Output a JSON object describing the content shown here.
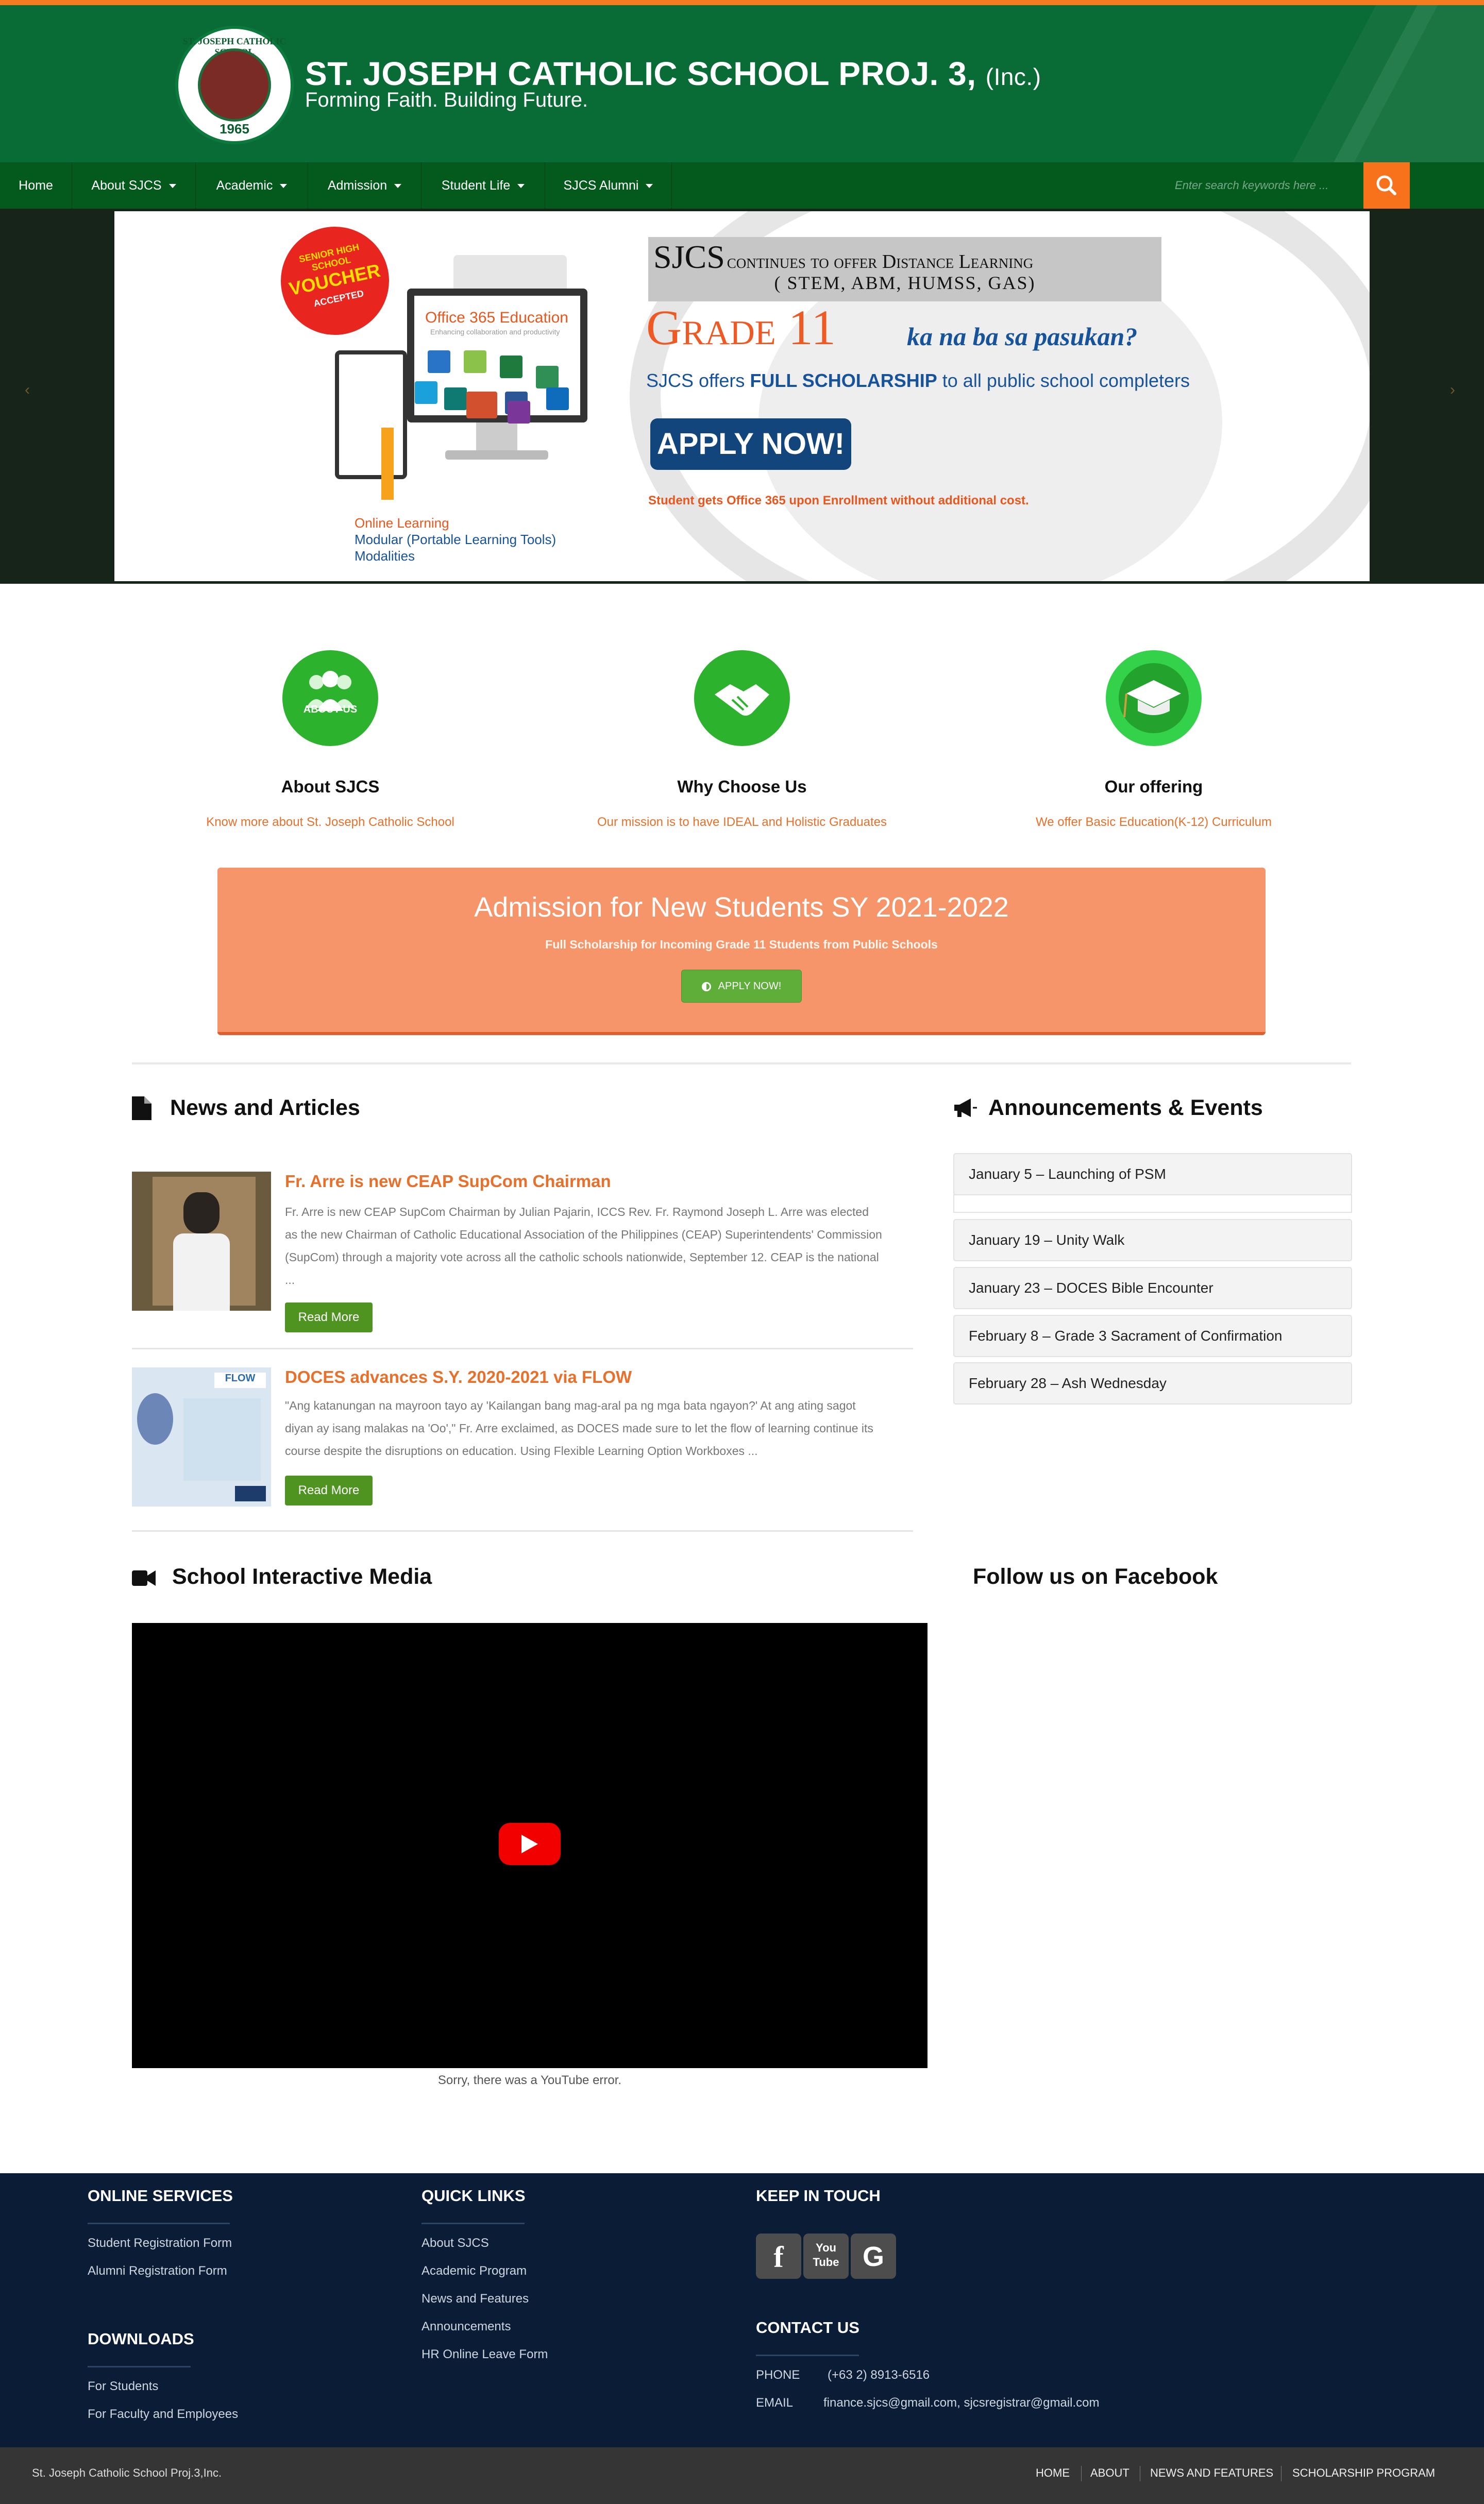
{
  "header": {
    "title": "ST. JOSEPH CATHOLIC SCHOOL PROJ. 3,",
    "title_suffix": "(Inc.)",
    "tagline": "Forming Faith. Building Future.",
    "logo_text": "ST. JOSEPH CATHOLIC SCHOOL",
    "logo_year": "1965"
  },
  "nav": {
    "items": [
      {
        "label": "Home"
      },
      {
        "label": "About SJCS"
      },
      {
        "label": "Academic"
      },
      {
        "label": "Admission"
      },
      {
        "label": "Student Life"
      },
      {
        "label": "SJCS Alumni"
      }
    ],
    "search_placeholder": "Enter search keywords here ..."
  },
  "slider": {
    "voucher": {
      "l1": "SENIOR HIGH SCHOOL",
      "l2": "VOUCHER",
      "l3": "ACCEPTED"
    },
    "office_label": "Office 365 Education",
    "office_sub": "Enhancing collaboration and productivity",
    "modes": [
      "Online Learning",
      "Modular (Portable Learning Tools)",
      "Modalities"
    ],
    "brand": "SJCS",
    "line1": "continues to offer Distance Learning",
    "line2": "( STEM, ABM, HUMSS, GAS)",
    "grade": "Grade 11",
    "tagline": "ka na ba sa pasukan?",
    "offer_pre": "SJCS offers ",
    "offer_bold": "FULL SCHOLARSHIP",
    "offer_post": " to all public school completers",
    "apply": "APPLY NOW!",
    "note": "Student gets Office 365 upon Enrollment without additional cost.",
    "prev": "‹",
    "next": "›"
  },
  "features": [
    {
      "badge": "ABOUT US",
      "title": "About SJCS",
      "link": "Know more about St. Joseph Catholic School"
    },
    {
      "badge": "",
      "title": "Why Choose Us",
      "link": "Our mission is to have IDEAL and Holistic Graduates"
    },
    {
      "badge": "",
      "title": "Our offering",
      "link": "We offer Basic Education(K-12) Curriculum"
    }
  ],
  "admission": {
    "title": "Admission for New Students SY 2021-2022",
    "subtitle": "Full Scholarship for Incoming Grade 11 Students from Public Schools",
    "button": "APPLY NOW!"
  },
  "news": {
    "heading": "News and Articles",
    "items": [
      {
        "title": "Fr. Arre is new CEAP SupCom Chairman",
        "body": "Fr. Arre is new CEAP SupCom Chairman by Julian Pajarin, ICCS Rev. Fr. Raymond Joseph L. Arre was elected as the new Chairman of Catholic Educational Association of the Philippines (CEAP) Superintendents' Commission (SupCom) through a majority vote across all the catholic schools nationwide, September 12. CEAP is the national ...",
        "button": "Read More"
      },
      {
        "title": "DOCES advances S.Y. 2020-2021 via FLOW",
        "body": "\"Ang katanungan na mayroon tayo ay 'Kailangan bang mag-aral pa ng mga bata ngayon?' At ang ating sagot diyan ay isang malakas na 'Oo',\" Fr. Arre exclaimed, as DOCES made sure to let the flow of learning continue its course despite the disruptions on education. Using Flexible Learning Option Workboxes ...",
        "button": "Read More",
        "thumb_text": "FLOW"
      }
    ]
  },
  "announcements": {
    "heading": "Announcements & Events",
    "items": [
      "January 5 – Launching of PSM",
      "January 19 – Unity Walk",
      "January 23 – DOCES Bible Encounter",
      "February 8 – Grade 3 Sacrament of Confirmation",
      "February 28 – Ash Wednesday"
    ]
  },
  "media": {
    "heading": "School Interactive Media",
    "error": "Sorry, there was a YouTube error."
  },
  "facebook": {
    "heading": "Follow us on Facebook"
  },
  "footer": {
    "online_services": {
      "heading": "ONLINE SERVICES",
      "links": [
        "Student Registration Form",
        "Alumni Registration Form"
      ]
    },
    "downloads": {
      "heading": "DOWNLOADS",
      "links": [
        "For Students",
        "For Faculty and Employees"
      ]
    },
    "quick_links": {
      "heading": "QUICK LINKS",
      "links": [
        "About SJCS",
        "Academic Program",
        "News and Features",
        "Announcements",
        "HR Online Leave Form"
      ]
    },
    "keep_in_touch": {
      "heading": "KEEP IN TOUCH",
      "icons": [
        "facebook-icon",
        "youtube-icon",
        "google-icon"
      ],
      "glyphs": [
        "f",
        "You Tube",
        "G"
      ]
    },
    "contact": {
      "heading": "CONTACT US",
      "phone_label": "PHONE",
      "phone": "(+63 2) 8913-6516",
      "email_label": "EMAIL",
      "email": "finance.sjcs@gmail.com, sjcsregistrar@gmail.com"
    }
  },
  "bottom": {
    "copyright": "St. Joseph Catholic School Proj.3,Inc.",
    "links": [
      "HOME",
      "ABOUT",
      "NEWS AND FEATURES",
      "SCHOLARSHIP PROGRAM"
    ]
  },
  "colors": {
    "header_green": "#096b35",
    "nav_green": "#045a1c",
    "accent_orange": "#f7721a",
    "footer_navy": "#0b1d36"
  }
}
